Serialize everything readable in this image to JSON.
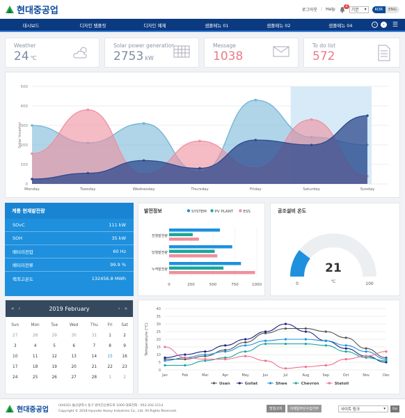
{
  "header": {
    "logo_text": "현대중공업",
    "login": "로그아웃",
    "help": "Help",
    "notif_count": "2",
    "select_value": "기본",
    "lang_on": "KOR",
    "lang_off": "ENG"
  },
  "nav": {
    "items": [
      "대시보드",
      "디자인 템플릿",
      "디자인 예제",
      "샘플메뉴 01",
      "샘플메뉴 02",
      "샘플메뉴 04"
    ]
  },
  "kpis": [
    {
      "label": "Weather",
      "value": "24",
      "unit": "℃",
      "color": "#7c8ba3",
      "icon": "cloud-sun-icon"
    },
    {
      "label": "Solar power generation",
      "value": "2753",
      "unit": "kW",
      "color": "#7c8ba3",
      "icon": "solar-panel-icon"
    },
    {
      "label": "Message",
      "value": "1038",
      "unit": "",
      "color": "#ea7a8a",
      "icon": "envelope-icon"
    },
    {
      "label": "To do list",
      "value": "572",
      "unit": "",
      "color": "#ea7a8a",
      "icon": "document-icon"
    }
  ],
  "chart_data": [
    {
      "type": "area",
      "categories": [
        "Monday",
        "Tuesday",
        "Wednesday",
        "Thursday",
        "Friday",
        "Saturday",
        "Sunday"
      ],
      "ylabel": "Solar Inverter",
      "ylim": [
        0,
        500
      ],
      "yticks": [
        0,
        100,
        200,
        300,
        400,
        500
      ],
      "series": [
        {
          "values": [
            300,
            210,
            310,
            60,
            430,
            240,
            200
          ],
          "color": "#6fb3d6"
        },
        {
          "values": [
            155,
            380,
            50,
            220,
            80,
            330,
            40
          ],
          "color": "#ef8f9e"
        },
        {
          "values": [
            25,
            55,
            120,
            80,
            225,
            200,
            350
          ],
          "color": "#2d4a8e"
        }
      ],
      "highlight": "Saturday"
    },
    {
      "type": "bar",
      "title": "발전정보",
      "categories": [
        "전월발전량",
        "당월발전량",
        "누적발전량"
      ],
      "xticks": [
        0,
        250,
        500,
        750,
        1000
      ],
      "xlim": [
        0,
        1000
      ],
      "series": [
        {
          "name": "SYSTEM",
          "color": "#1e90de",
          "values": [
            580,
            720,
            820
          ]
        },
        {
          "name": "PV PLANT",
          "color": "#18a89a",
          "values": [
            270,
            520,
            620
          ]
        },
        {
          "name": "ESS",
          "color": "#ef8f9e",
          "values": [
            340,
            550,
            980
          ]
        }
      ]
    },
    {
      "type": "gauge",
      "title": "공조설비 온도",
      "value": 21,
      "unit": "℃",
      "min": 0,
      "max": 100,
      "color": "#1e90de"
    },
    {
      "type": "line",
      "categories": [
        "Jan",
        "Feb",
        "Mar",
        "Apr",
        "May",
        "Jun",
        "Jul",
        "Aug",
        "Sep",
        "Oct",
        "Nov",
        "Dec"
      ],
      "ylabel": "Temperature (°C)",
      "ylim": [
        0,
        40
      ],
      "yticks": [
        0,
        5,
        10,
        15,
        20,
        25,
        30,
        35,
        40
      ],
      "series": [
        {
          "name": "Usan",
          "color": "#555555",
          "values": [
            7,
            7,
            9,
            13,
            18,
            24,
            27,
            27,
            25,
            21,
            14,
            8
          ]
        },
        {
          "name": "Goliat",
          "color": "#1a237e",
          "values": [
            8,
            10,
            12,
            16,
            20,
            25,
            30,
            25,
            19,
            14,
            9,
            5
          ]
        },
        {
          "name": "Shwe",
          "color": "#1e90de",
          "values": [
            6,
            8,
            10,
            12,
            16,
            19,
            20,
            20,
            19,
            16,
            12,
            7
          ]
        },
        {
          "name": "Chevron",
          "color": "#18a89a",
          "values": [
            3,
            3,
            6,
            8,
            12,
            17,
            17,
            17,
            16,
            12,
            8,
            6
          ]
        },
        {
          "name": "Statoil",
          "color": "#ef6f8e",
          "values": [
            15,
            8,
            7,
            7,
            9,
            6,
            1,
            2,
            3,
            7,
            9,
            12
          ]
        }
      ]
    }
  ],
  "power_panel": {
    "title": "계통 현재발전량",
    "rows": [
      {
        "label": "SOvC",
        "value": "111 kW"
      },
      {
        "label": "SOH",
        "value": "35 kW"
      },
      {
        "label": "배터리전압",
        "value": "60 Hz"
      },
      {
        "label": "배터리전류",
        "value": "99.9 %"
      },
      {
        "label": "랙최고온도",
        "value": "132456.8 MWh"
      }
    ]
  },
  "calendar": {
    "title": "2019  February",
    "weekdays": [
      "Sun",
      "Mon",
      "Tue",
      "Wed",
      "Thu",
      "Fri",
      "Sat"
    ],
    "weeks": [
      [
        [
          "27",
          1
        ],
        [
          "28",
          1
        ],
        [
          "29",
          1
        ],
        [
          "30",
          1
        ],
        [
          "31",
          1
        ],
        [
          "1",
          0
        ],
        [
          "2",
          0
        ]
      ],
      [
        [
          "3",
          0
        ],
        [
          "4",
          0
        ],
        [
          "5",
          0
        ],
        [
          "6",
          0
        ],
        [
          "7",
          0
        ],
        [
          "8",
          0
        ],
        [
          "9",
          0
        ]
      ],
      [
        [
          "10",
          0
        ],
        [
          "11",
          0
        ],
        [
          "12",
          0
        ],
        [
          "13",
          0
        ],
        [
          "14",
          0
        ],
        [
          "15",
          2
        ],
        [
          "16",
          0
        ]
      ],
      [
        [
          "17",
          0
        ],
        [
          "18",
          0
        ],
        [
          "19",
          0
        ],
        [
          "20",
          0
        ],
        [
          "21",
          0
        ],
        [
          "22",
          0
        ],
        [
          "23",
          0
        ]
      ],
      [
        [
          "24",
          0
        ],
        [
          "25",
          0
        ],
        [
          "26",
          0
        ],
        [
          "27",
          0
        ],
        [
          "28",
          0
        ],
        [
          "1",
          1
        ],
        [
          "2",
          1
        ]
      ]
    ]
  },
  "footer": {
    "address": "(44032) 울산광역시 동구 방어진순환도로 1000 대표전화 : 052-202-2114",
    "copyright": "Copyright © 2018 Hyundai Heavy Industries Co., Ltd. All Rights Reserved.",
    "btn1": "방침고지",
    "btn2": "이메일무단수집거부",
    "site_select": "사이트 링크",
    "go": "Go"
  }
}
